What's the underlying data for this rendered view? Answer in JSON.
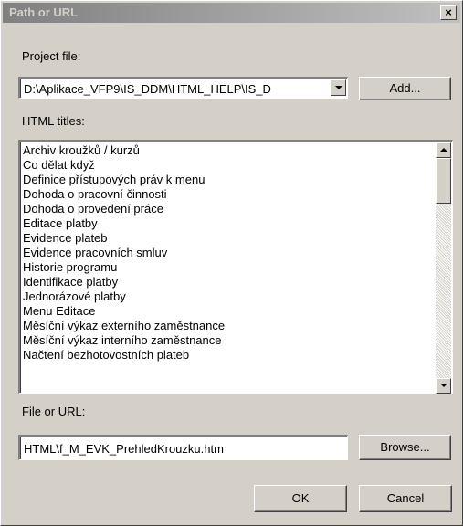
{
  "window": {
    "title": "Path or URL",
    "close_glyph": "×"
  },
  "project": {
    "label": "Project file:",
    "value": "D:\\Aplikace_VFP9\\IS_DDM\\HTML_HELP\\IS_D",
    "add_label": "Add..."
  },
  "titles": {
    "label": "HTML titles:",
    "items": [
      "Archiv kroužků / kurzů",
      "Co dělat když",
      "Definice přístupových práv k menu",
      "Dohoda o pracovní činnosti",
      "Dohoda o provedení práce",
      "Editace platby",
      "Evidence plateb",
      "Evidence pracovních smluv",
      "Historie programu",
      "Identifikace platby",
      "Jednorázové platby",
      "Menu Editace",
      "Měsíční výkaz externího zaměstnance",
      "Měsíční výkaz interního zaměstnance",
      "Načtení bezhotovostních plateb"
    ],
    "scroll_fraction": 0.0
  },
  "file": {
    "label": "File or URL:",
    "value": "HTML\\f_M_EVK_PrehledKrouzku.htm",
    "browse_label": "Browse..."
  },
  "footer": {
    "ok_label": "OK",
    "cancel_label": "Cancel"
  },
  "colors": {
    "face": "#d4d0c8",
    "title_gradient_start": "#808080",
    "title_gradient_end": "#c0c0c0",
    "title_text": "#d4d0c8"
  }
}
